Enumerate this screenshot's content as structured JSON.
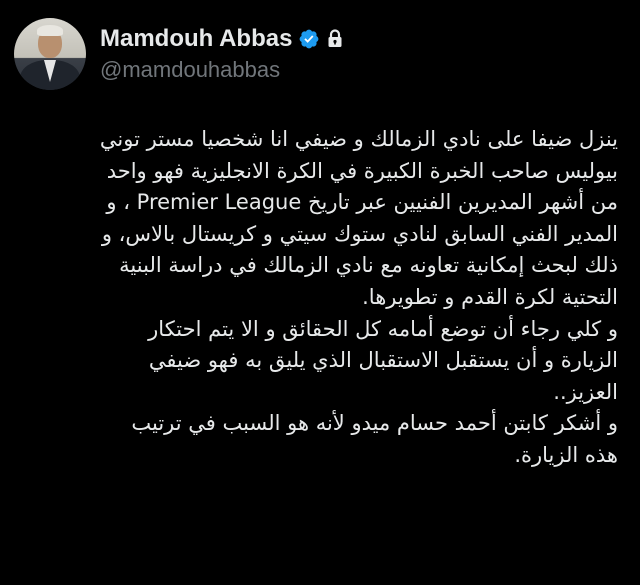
{
  "author": {
    "display_name": "Mamdouh Abbas",
    "handle": "@mamdouhabbas",
    "verified_icon": "verified-badge-icon",
    "protected_icon": "lock-icon",
    "badge_color": "#1d9bf0"
  },
  "tweet": {
    "text": "ينزل ضيفا على نادي الزمالك و ضيفي انا شخصيا مستر توني\nبيوليس صاحب الخبرة الكبيرة في الكرة الانجليزية فهو واحد\nمن أشهر المديرين الفنيين عبر تاريخ Premier League ، و\nالمدير الفني السابق لنادي ستوك سيتي و كريستال بالاس، و\nذلك لبحث إمكانية تعاونه مع نادي الزمالك في دراسة البنية\nالتحتية لكرة القدم و تطويرها.\nو كلي رجاء أن توضع أمامه كل الحقائق و الا يتم احتكار\nالزيارة و أن يستقبل الاستقبال الذي يليق به فهو ضيفي\nالعزيز..\nو أشكر كابتن أحمد حسام ميدو لأنه هو السبب في ترتيب\nهذه الزيارة."
  },
  "colors": {
    "background": "#000000",
    "text": "#e7e9ea",
    "secondary_text": "#71767b"
  }
}
